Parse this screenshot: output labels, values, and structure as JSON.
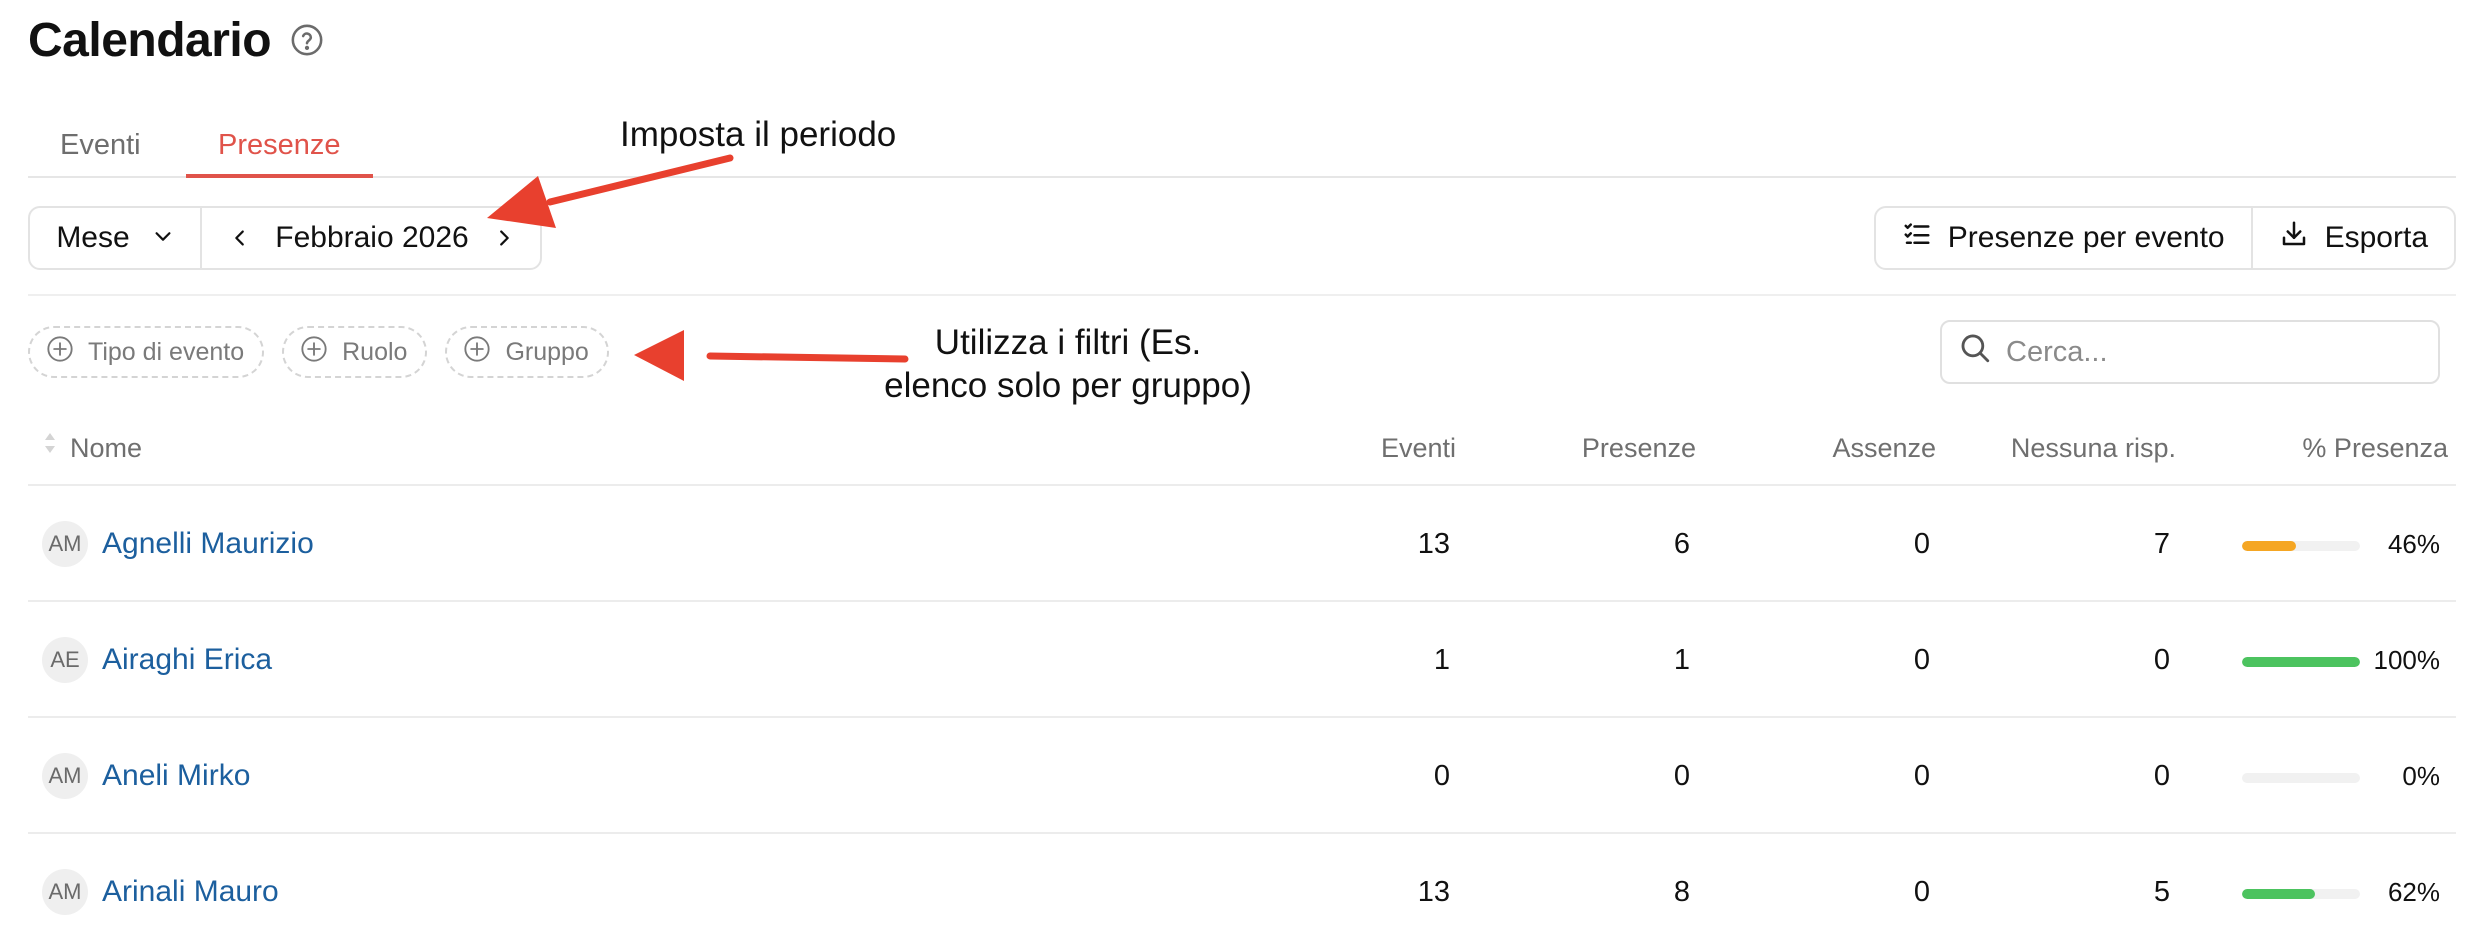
{
  "page": {
    "title": "Calendario",
    "help_icon": "question-circle-icon"
  },
  "tabs": [
    {
      "label": "Eventi",
      "active": false
    },
    {
      "label": "Presenze",
      "active": true
    }
  ],
  "period": {
    "mode": "Mese",
    "current": "Febbraio 2026"
  },
  "actions": {
    "presenze_per_evento": "Presenze per evento",
    "esporta": "Esporta"
  },
  "filters": [
    "Tipo di evento",
    "Ruolo",
    "Gruppo"
  ],
  "search": {
    "placeholder": "Cerca..."
  },
  "table": {
    "columns": {
      "nome": "Nome",
      "eventi": "Eventi",
      "presenze": "Presenze",
      "assenze": "Assenze",
      "nessuna": "Nessuna risp.",
      "percent": "% Presenza"
    },
    "rows": [
      {
        "initials": "AM",
        "name": "Agnelli Maurizio",
        "eventi": "13",
        "presenze": "6",
        "assenze": "0",
        "nessuna": "7",
        "percent": "46%",
        "percent_value": 46,
        "bar_color": "#f5a623"
      },
      {
        "initials": "AE",
        "name": "Airaghi Erica",
        "eventi": "1",
        "presenze": "1",
        "assenze": "0",
        "nessuna": "0",
        "percent": "100%",
        "percent_value": 100,
        "bar_color": "#4cc35f"
      },
      {
        "initials": "AM",
        "name": "Aneli Mirko",
        "eventi": "0",
        "presenze": "0",
        "assenze": "0",
        "nessuna": "0",
        "percent": "0%",
        "percent_value": 0,
        "bar_color": "#4cc35f"
      },
      {
        "initials": "AM",
        "name": "Arinali Mauro",
        "eventi": "13",
        "presenze": "8",
        "assenze": "0",
        "nessuna": "5",
        "percent": "62%",
        "percent_value": 62,
        "bar_color": "#4cc35f"
      }
    ]
  },
  "annotations": {
    "period": "Imposta il periodo",
    "filters_line1": "Utilizza i filtri (Es.",
    "filters_line2": "elenco solo per gruppo)",
    "arrow_color": "#e8402e"
  }
}
